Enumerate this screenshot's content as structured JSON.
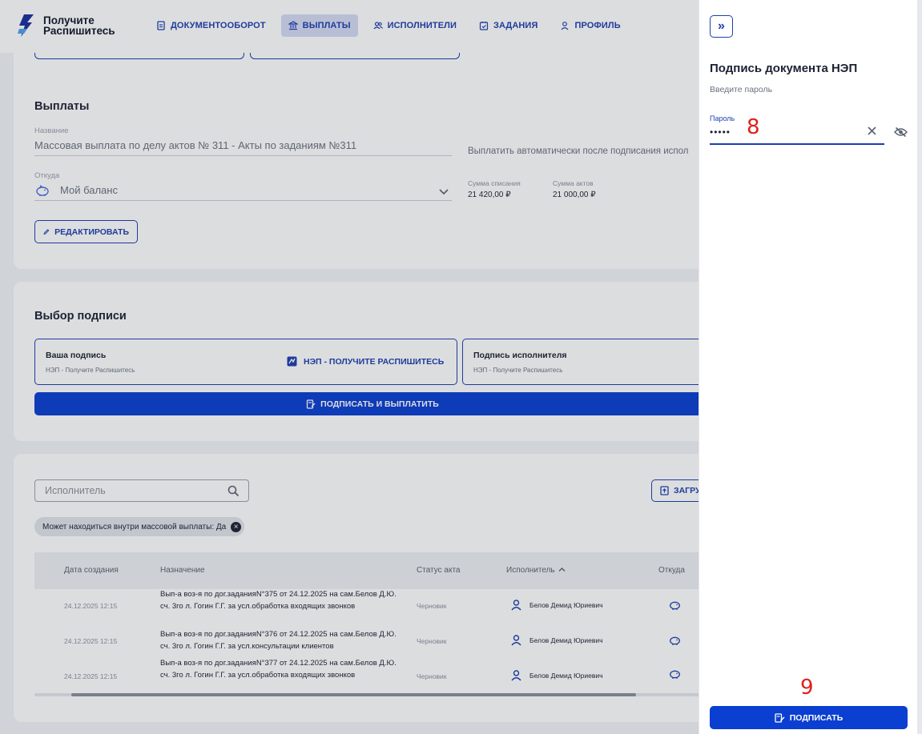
{
  "brand": {
    "line1": "Получите",
    "line2": "Распишитесь"
  },
  "nav": [
    {
      "label": "ДОКУМЕНТООБОРОТ",
      "icon": "document-icon"
    },
    {
      "label": "ВЫПЛАТЫ",
      "icon": "bank-icon",
      "active": true
    },
    {
      "label": "ИСПОЛНИТЕЛИ",
      "icon": "users-icon"
    },
    {
      "label": "ЗАДАНИЯ",
      "icon": "calendar-check-icon"
    },
    {
      "label": "ПРОФИЛЬ",
      "icon": "user-icon"
    }
  ],
  "payout": {
    "heading": "Выплаты",
    "name_label": "Название",
    "name_value": "Массовая выплата по делу актов № 311 - Акты по заданиям №311",
    "auto_pay_text": "Выплатить автоматически после подписания испол",
    "from_label": "Откуда",
    "from_value": "Мой баланс",
    "debit_label": "Сумма списания",
    "debit_value": "21 420,00 ₽",
    "acts_label": "Сумма актов",
    "acts_value": "21 000,00 ₽",
    "edit_button": "РЕДАКТИРОВАТЬ"
  },
  "signature": {
    "heading": "Выбор подписи",
    "your_title": "Ваша подпись",
    "your_sub": "НЭП - Получите Распишитесь",
    "your_method": "НЭП - ПОЛУЧИТЕ РАСПИШИТЕСЬ",
    "exec_title": "Подпись исполнителя",
    "exec_sub": "НЭП - Получите Распишитесь",
    "sign_pay_button": "ПОДПИСАТЬ И ВЫПЛАТИТЬ"
  },
  "list": {
    "search_placeholder": "Исполнитель",
    "upload_button": "ЗАГРУ",
    "filter_chip": "Может находиться внутри массовой выплаты: Да",
    "columns": {
      "date": "Дата создания",
      "purpose": "Назначение",
      "status": "Статус акта",
      "executor": "Исполнитель",
      "from": "Откуда"
    },
    "rows": [
      {
        "date": "24.12.2025 12:15",
        "purpose": "Вып-а воз-я по дог.заданияN°375 от 24.12.2025 на сам.Белов Д.Ю. сч. 3го л. Гогин Г.Г. за усл.обработка входящих звонков",
        "status": "Черновик",
        "executor": "Белов Демид Юриевич"
      },
      {
        "date": "24.12.2025 12:15",
        "purpose": "Вып-а воз-я по дог.заданияN°376 от 24.12.2025 на сам.Белов Д.Ю. сч. 3го л. Гогин Г.Г. за усл.консультации клиентов",
        "status": "Черновик",
        "executor": "Белов Демид Юриевич"
      },
      {
        "date": "24.12.2025 12:15",
        "purpose": "Вып-а воз-я по дог.заданияN°377 от 24.12.2025 на сам.Белов Д.Ю. сч. 3го л. Гогин Г.Г. за усл.обработка входящих звонков",
        "status": "Черновик",
        "executor": "Белов Демид Юриевич"
      }
    ]
  },
  "panel": {
    "collapse": "»",
    "title": "Подпись документа НЭП",
    "subtitle": "Введите пароль",
    "password_label": "Пароль",
    "password_value": "•••••",
    "marker_1": "8",
    "marker_2": "9",
    "sign_button": "ПОДПИСАТЬ"
  },
  "colors": {
    "primary": "#0a3fd1",
    "accent": "#1e3fae",
    "marker": "#e0201c"
  }
}
